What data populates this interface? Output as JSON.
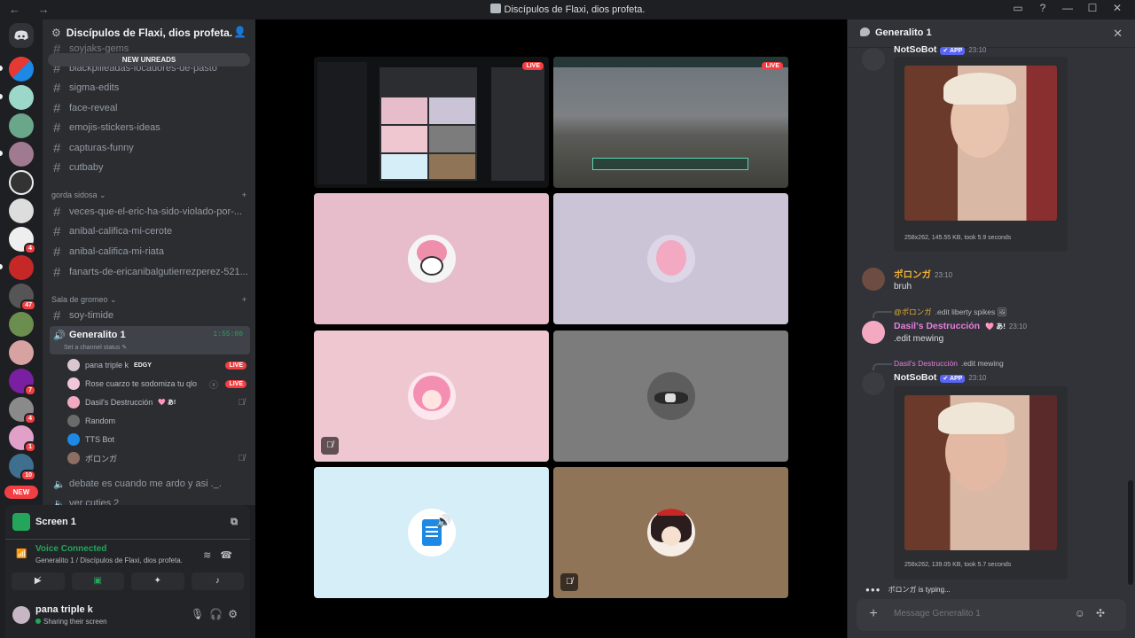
{
  "window": {
    "title": "Discípulos de Flaxi, dios profeta.",
    "nav": "← →",
    "controls": [
      "▭",
      "?",
      "—",
      "☐",
      "✕"
    ]
  },
  "guilds": {
    "badges": [
      "4",
      "47",
      "7",
      "4",
      "1",
      "10"
    ],
    "new_label": "NEW"
  },
  "server": {
    "name": "Discípulos de Flaxi, dios profeta.",
    "new_unreads": "NEW UNREADS"
  },
  "channels_top": [
    "soyjaks-gems",
    "blackpilleadas-locadores-de-pasto",
    "sigma-edits",
    "face-reveal",
    "emojis-stickers-ideas",
    "capturas-funny",
    "cutbaby"
  ],
  "category1": "gorda sidosa",
  "channels_mid": [
    "veces-que-el-eric-ha-sido-violado-por-...",
    "anibal-califica-mi-cerote",
    "anibal-califica-mi-riata",
    "fanarts-de-ericanibalgutierrezperez-521..."
  ],
  "category2": "Sala de gromeo",
  "channel_soy": "soy-timide",
  "voice": {
    "name": "Generalito 1",
    "timer": "1:55:00",
    "status_hint": "Set a channel status"
  },
  "voice_users": [
    {
      "name": "pana triple k",
      "tag": "EDGY",
      "live": "LIVE"
    },
    {
      "name": "Rose cuarzo te sodomiza tu qlo",
      "tag": "",
      "live": "LIVE"
    },
    {
      "name": "Dasil's Destrucción",
      "tag": "🩷 あ!",
      "live": ""
    },
    {
      "name": "Random",
      "tag": "",
      "live": ""
    },
    {
      "name": "TTS Bot",
      "tag": "",
      "live": ""
    },
    {
      "name": "ポロンガ",
      "tag": "",
      "live": ""
    }
  ],
  "channels_bottom": [
    "debate es cuando me ardo y asi ._.",
    "ver cuties 2"
  ],
  "panel": {
    "screen": "Screen 1",
    "voice_connected": "Voice Connected",
    "voice_sub": "Generalito 1 / Discípulos de Flaxi, dios profeta.",
    "user": "pana triple k",
    "user_status": "Sharing their screen"
  },
  "stage": {
    "live1": "LIVE",
    "live2": "LIVE"
  },
  "chat": {
    "title": "Generalito 1",
    "m1": {
      "author": "NotSoBot",
      "app": "✔ APP",
      "time": "23:10",
      "footer": "258x262, 145.55 KB, took 5.9 seconds"
    },
    "m2": {
      "author": "ポロンガ",
      "time": "23:10",
      "text": "bruh"
    },
    "m3": {
      "reply_name": "@ポロンガ",
      "reply_text": ".edit liberty spikes",
      "author": "Dasil's Destrucción",
      "tags": "🩷 あ!",
      "time": "23:10",
      "text": ".edit mewing"
    },
    "m4": {
      "reply_name": "Dasil's Destrucción",
      "reply_text": ".edit mewing",
      "author": "NotSoBot",
      "app": "✔ APP",
      "time": "23:10",
      "footer": "258x262, 139.05 KB, took 5.7 seconds"
    },
    "typing": "ポロンガ is typing...",
    "input_placeholder": "Message Generalito 1"
  },
  "colors": {
    "accent": "#5865f2",
    "live": "#f23f43",
    "online": "#23a55a"
  }
}
